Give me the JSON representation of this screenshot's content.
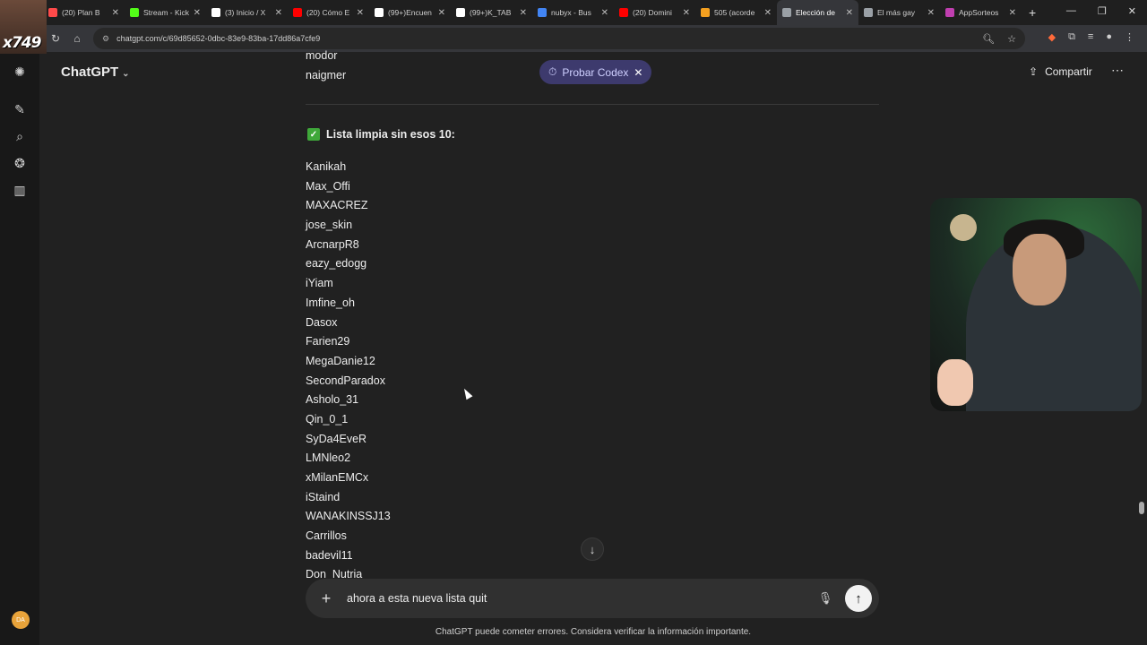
{
  "browser": {
    "tabs": [
      {
        "label": "(20) Plan B",
        "fav_color": "#ff4a4a"
      },
      {
        "label": "Stream - Kick",
        "fav_color": "#53fc18"
      },
      {
        "label": "(3) Inicio / X",
        "fav_color": "#ffffff"
      },
      {
        "label": "(20) Cómo E",
        "fav_color": "#ff0000"
      },
      {
        "label": "(99+)Encuen",
        "fav_color": "#ffffff"
      },
      {
        "label": "(99+)K_TAB",
        "fav_color": "#ffffff"
      },
      {
        "label": "nubyx - Bus",
        "fav_color": "#4285f4"
      },
      {
        "label": "(20) Domini",
        "fav_color": "#ff0000"
      },
      {
        "label": "505 (acorde",
        "fav_color": "#f4a020"
      },
      {
        "label": "Elección de",
        "fav_color": "#9aa0a6",
        "active": true
      },
      {
        "label": "El más gay",
        "fav_color": "#9aa0a6"
      },
      {
        "label": "AppSorteos",
        "fav_color": "#c03fb0"
      }
    ],
    "url": "chatgpt.com/c/69d85652-0dbc-83e9-83ba-17dd86a7cfe9",
    "stream_overlay": "x749"
  },
  "app": {
    "title": "ChatGPT",
    "promo_pill": "Probar Codex",
    "share_label": "Compartir"
  },
  "previous_lines": [
    "modor",
    "naigmer"
  ],
  "section_heading": "Lista limpia sin esos 10:",
  "names": [
    "Kanikah",
    "Max_Offi",
    "MAXACREZ",
    "jose_skin",
    "ArcnarpR8",
    "eazy_edogg",
    "iYiam",
    "Imfine_oh",
    "Dasox",
    "Farien29",
    "MegaDanie12",
    "SecondParadox",
    "Asholo_31",
    "Qin_0_1",
    "SyDa4EveR",
    "LMNleo2",
    "xMilanEMCx",
    "iStaind",
    "WANAKINSSJ13",
    "Carrillos",
    "badevil11",
    "Don_Nutria"
  ],
  "composer": {
    "value": "ahora a esta nueva lista quit"
  },
  "footer": "ChatGPT puede cometer errores. Considera verificar la información importante.",
  "user_initials": "DA"
}
